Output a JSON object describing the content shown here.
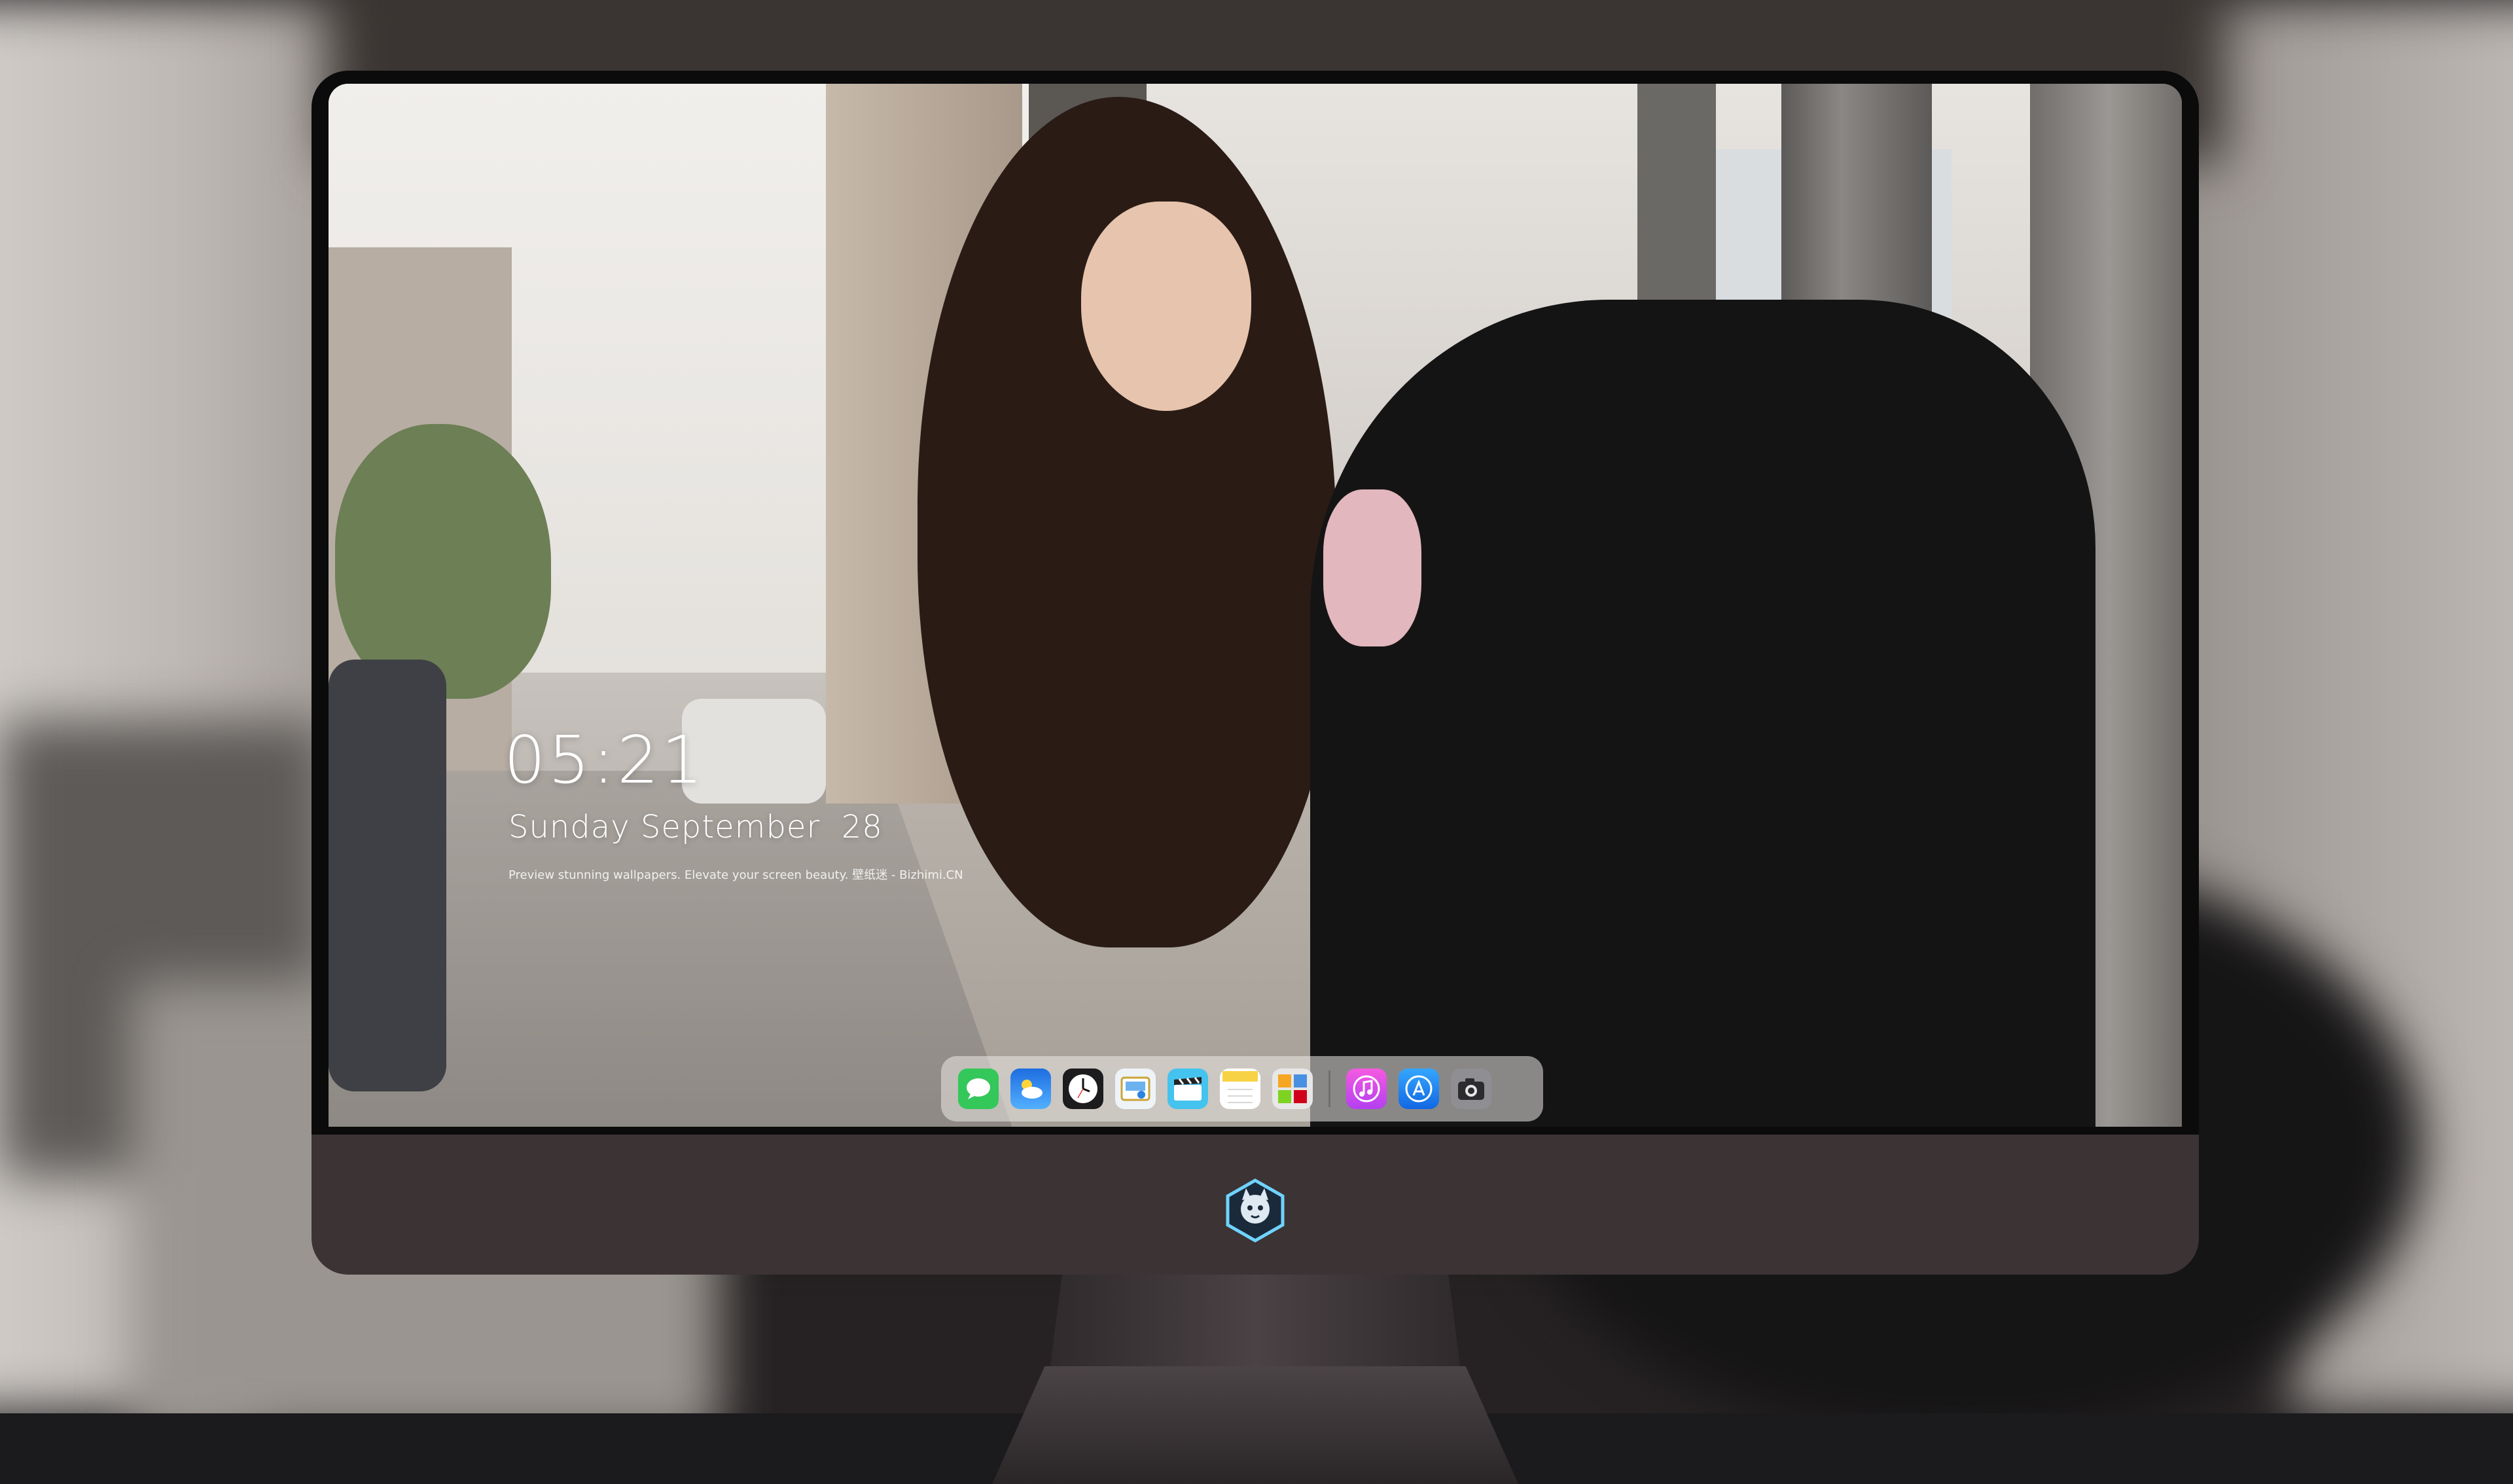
{
  "wallpaper": {
    "clock": "05:21",
    "date": "Sunday September  28",
    "tagline": "Preview stunning wallpapers. Elevate your screen beauty. 壁纸迷 - Bizhimi.CN"
  },
  "dock": {
    "apps": [
      {
        "name": "Messages",
        "icon": "messages-icon",
        "color": "#34c759"
      },
      {
        "name": "Weather",
        "icon": "weather-icon",
        "color": "#2f8cf6"
      },
      {
        "name": "Clock",
        "icon": "clock-icon",
        "color": "#1c1c1e"
      },
      {
        "name": "Preview",
        "icon": "preview-icon",
        "color": "#f0c13a"
      },
      {
        "name": "Clips",
        "icon": "clips-icon",
        "color": "#44c3ef"
      },
      {
        "name": "Notes",
        "icon": "notes-icon",
        "color": "#f7d244"
      },
      {
        "name": "Photo Booth",
        "icon": "photo-booth-icon",
        "color": "#d9d9d9"
      },
      {
        "name": "iTunes",
        "icon": "itunes-icon",
        "color": "#e845c8"
      },
      {
        "name": "App Store",
        "icon": "app-store-icon",
        "color": "#1e8bf5"
      },
      {
        "name": "Camera",
        "icon": "camera-icon",
        "color": "#8e8e93"
      }
    ],
    "active_indicator": "running"
  },
  "monitor": {
    "logo": "mascot-logo-icon",
    "colors": {
      "chin": "#3b3334",
      "bezel": "#0b0b0c"
    }
  }
}
